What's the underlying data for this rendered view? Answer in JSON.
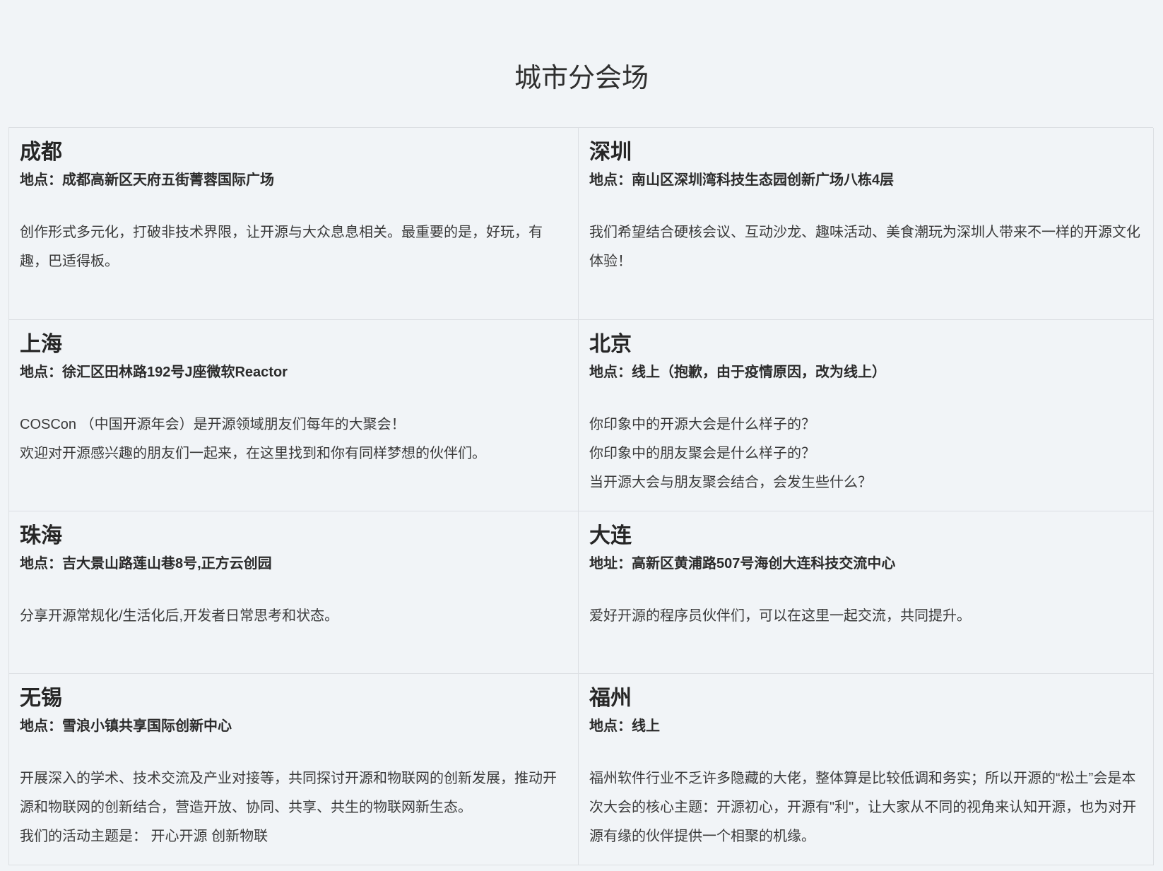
{
  "section": {
    "title": "城市分会场"
  },
  "cards": [
    {
      "city": "成都",
      "location": "地点：成都高新区天府五街菁蓉国际广场",
      "description": [
        "创作形式多元化，打破非技术界限，让开源与大众息息相关。最重要的是，好玩，有趣，巴适得板。"
      ]
    },
    {
      "city": "深圳",
      "location": "地点：南山区深圳湾科技生态园创新广场八栋4层",
      "description": [
        "我们希望结合硬核会议、互动沙龙、趣味活动、美食潮玩为深圳人带来不一样的开源文化体验！"
      ]
    },
    {
      "city": "上海",
      "location": "地点：徐汇区田林路192号J座微软Reactor",
      "description": [
        "COSCon （中国开源年会）是开源领域朋友们每年的大聚会！",
        "欢迎对开源感兴趣的朋友们一起来，在这里找到和你有同样梦想的伙伴们。"
      ]
    },
    {
      "city": "北京",
      "location": "地点：线上（抱歉，由于疫情原因，改为线上）",
      "description": [
        "你印象中的开源大会是什么样子的？",
        "你印象中的朋友聚会是什么样子的？",
        "当开源大会与朋友聚会结合，会发生些什么？"
      ]
    },
    {
      "city": "珠海",
      "location": "地点：吉大景山路莲山巷8号,正方云创园",
      "description": [
        "分享开源常规化/生活化后,开发者日常思考和状态。"
      ]
    },
    {
      "city": "大连",
      "location": "地址：高新区黄浦路507号海创大连科技交流中心",
      "description": [
        "爱好开源的程序员伙伴们，可以在这里一起交流，共同提升。"
      ]
    },
    {
      "city": "无锡",
      "location": "地点：雪浪小镇共享国际创新中心",
      "description": [
        "开展深入的学术、技术交流及产业对接等，共同探讨开源和物联网的创新发展，推动开源和物联网的创新结合，营造开放、协同、共享、共生的物联网新生态。",
        "我们的活动主题是：  开心开源   创新物联"
      ]
    },
    {
      "city": "福州",
      "location": "地点：线上",
      "description": [
        "福州软件行业不乏许多隐藏的大佬，整体算是比较低调和务实；所以开源的“松土”会是本次大会的核心主题：开源初心，开源有\"利\"，让大家从不同的视角来认知开源，也为对开源有缘的伙伴提供一个相聚的机缘。"
      ]
    }
  ]
}
